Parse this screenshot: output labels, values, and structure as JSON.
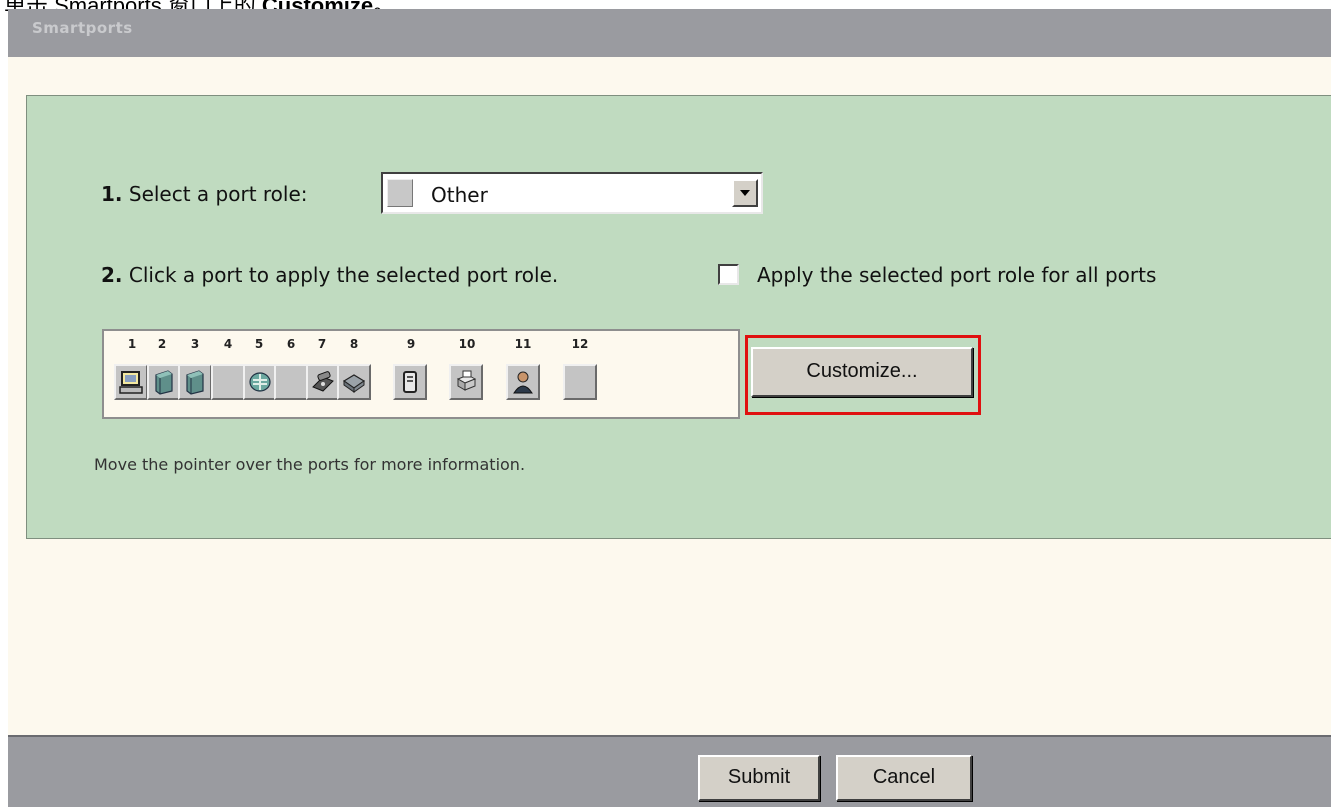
{
  "caption": {
    "prefix": "单击 Smartports 窗口上的 ",
    "bold": "Customize",
    "suffix": "。"
  },
  "window": {
    "title": "Smartports"
  },
  "step1": {
    "number": "1.",
    "text": " Select a port role:",
    "selected_role": "Other"
  },
  "step2": {
    "number": "2.",
    "text": " Click a port to apply the selected port role.",
    "apply_all_label": "Apply the selected port role for all ports",
    "apply_all_checked": false
  },
  "ports": {
    "numbers": [
      "1",
      "2",
      "3",
      "4",
      "5",
      "6",
      "7",
      "8",
      "9",
      "10",
      "11",
      "12"
    ],
    "icons": [
      "desktop-icon",
      "switch-icon",
      "switch-icon",
      "empty-port-icon",
      "router-icon",
      "empty-port-icon",
      "ip-phone-icon",
      "access-point-icon",
      "server-icon",
      "printer-icon",
      "user-icon",
      "empty-port-icon"
    ]
  },
  "buttons": {
    "customize": "Customize...",
    "submit": "Submit",
    "cancel": "Cancel"
  },
  "hint": "Move the pointer over the ports for more information.",
  "colors": {
    "panel": "#c0dbc0",
    "body": "#fdf9ee",
    "bars": "#9a9ba0",
    "highlight": "#e01010"
  }
}
